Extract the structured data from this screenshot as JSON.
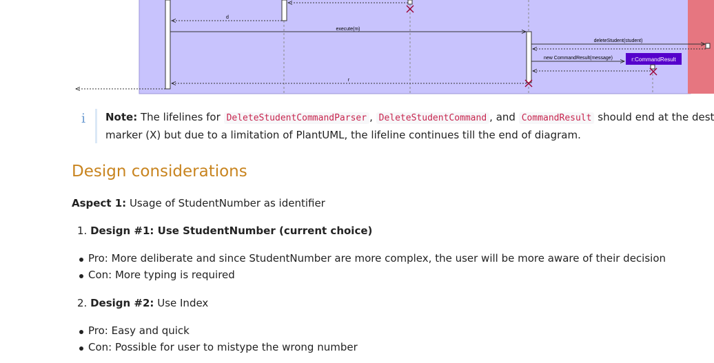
{
  "diagram": {
    "msg_d": "d",
    "msg_execute": "execute(m)",
    "msg_delete": "deleteStudent(student)",
    "msg_new_result": "new CommandResult(message)",
    "result_box": "r:CommandResult",
    "msg_r": "r",
    "colors": {
      "frame": "#c8c3fd",
      "side_band": "#e67680",
      "box": "#5500cc",
      "destroy": "#990033"
    }
  },
  "note": {
    "icon": "info-icon",
    "label": "Note:",
    "t1": "The lifelines for",
    "c1": "DeleteStudentCommandParser",
    "t2": ",",
    "c2": "DeleteStudentCommand",
    "t3": ", and",
    "c3": "CommandResult",
    "t4": "should end at the destroy",
    "line2": "marker (X) but due to a limitation of PlantUML, the lifeline continues till the end of diagram."
  },
  "design": {
    "heading": "Design considerations",
    "aspect_label": "Aspect 1:",
    "aspect_text": "Usage of StudentNumber as identifier",
    "d1_num": "1.",
    "d1_text": "Design #1: Use StudentNumber (current choice)",
    "d1_pro": "Pro: More deliberate and since StudentNumber are more complex, the user will be more aware of their decision",
    "d1_con": "Con: More typing is required",
    "d2_num": "2.",
    "d2_label": "Design #2:",
    "d2_text": "Use Index",
    "d2_pro": "Pro: Easy and quick",
    "d2_con": "Con: Possible for user to mistype the wrong number"
  }
}
